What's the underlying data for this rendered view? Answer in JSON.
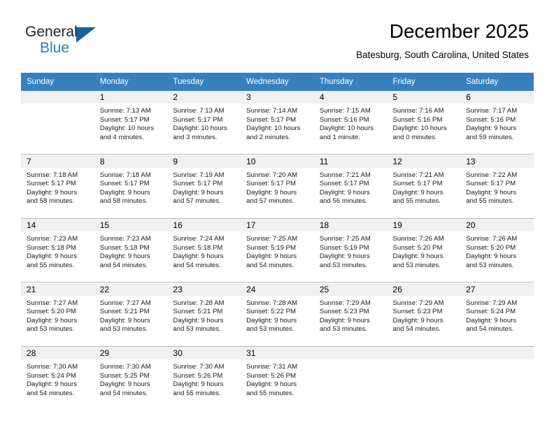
{
  "brand": {
    "name_part1": "General",
    "name_part2": "Blue"
  },
  "header": {
    "month_title": "December 2025",
    "location": "Batesburg, South Carolina, United States"
  },
  "colors": {
    "header_band": "#3680bf",
    "daynum_band": "#f0f0f0",
    "brand_blue": "#1f7fc4",
    "logo_triangle": "#1464a5"
  },
  "weekday_headers": [
    "Sunday",
    "Monday",
    "Tuesday",
    "Wednesday",
    "Thursday",
    "Friday",
    "Saturday"
  ],
  "weeks": [
    [
      {
        "day": "",
        "sunrise": "",
        "sunset": "",
        "daylight1": "",
        "daylight2": ""
      },
      {
        "day": "1",
        "sunrise": "Sunrise: 7:13 AM",
        "sunset": "Sunset: 5:17 PM",
        "daylight1": "Daylight: 10 hours",
        "daylight2": "and 4 minutes."
      },
      {
        "day": "2",
        "sunrise": "Sunrise: 7:13 AM",
        "sunset": "Sunset: 5:17 PM",
        "daylight1": "Daylight: 10 hours",
        "daylight2": "and 3 minutes."
      },
      {
        "day": "3",
        "sunrise": "Sunrise: 7:14 AM",
        "sunset": "Sunset: 5:17 PM",
        "daylight1": "Daylight: 10 hours",
        "daylight2": "and 2 minutes."
      },
      {
        "day": "4",
        "sunrise": "Sunrise: 7:15 AM",
        "sunset": "Sunset: 5:16 PM",
        "daylight1": "Daylight: 10 hours",
        "daylight2": "and 1 minute."
      },
      {
        "day": "5",
        "sunrise": "Sunrise: 7:16 AM",
        "sunset": "Sunset: 5:16 PM",
        "daylight1": "Daylight: 10 hours",
        "daylight2": "and 0 minutes."
      },
      {
        "day": "6",
        "sunrise": "Sunrise: 7:17 AM",
        "sunset": "Sunset: 5:16 PM",
        "daylight1": "Daylight: 9 hours",
        "daylight2": "and 59 minutes."
      }
    ],
    [
      {
        "day": "7",
        "sunrise": "Sunrise: 7:18 AM",
        "sunset": "Sunset: 5:17 PM",
        "daylight1": "Daylight: 9 hours",
        "daylight2": "and 58 minutes."
      },
      {
        "day": "8",
        "sunrise": "Sunrise: 7:18 AM",
        "sunset": "Sunset: 5:17 PM",
        "daylight1": "Daylight: 9 hours",
        "daylight2": "and 58 minutes."
      },
      {
        "day": "9",
        "sunrise": "Sunrise: 7:19 AM",
        "sunset": "Sunset: 5:17 PM",
        "daylight1": "Daylight: 9 hours",
        "daylight2": "and 57 minutes."
      },
      {
        "day": "10",
        "sunrise": "Sunrise: 7:20 AM",
        "sunset": "Sunset: 5:17 PM",
        "daylight1": "Daylight: 9 hours",
        "daylight2": "and 57 minutes."
      },
      {
        "day": "11",
        "sunrise": "Sunrise: 7:21 AM",
        "sunset": "Sunset: 5:17 PM",
        "daylight1": "Daylight: 9 hours",
        "daylight2": "and 56 minutes."
      },
      {
        "day": "12",
        "sunrise": "Sunrise: 7:21 AM",
        "sunset": "Sunset: 5:17 PM",
        "daylight1": "Daylight: 9 hours",
        "daylight2": "and 55 minutes."
      },
      {
        "day": "13",
        "sunrise": "Sunrise: 7:22 AM",
        "sunset": "Sunset: 5:17 PM",
        "daylight1": "Daylight: 9 hours",
        "daylight2": "and 55 minutes."
      }
    ],
    [
      {
        "day": "14",
        "sunrise": "Sunrise: 7:23 AM",
        "sunset": "Sunset: 5:18 PM",
        "daylight1": "Daylight: 9 hours",
        "daylight2": "and 55 minutes."
      },
      {
        "day": "15",
        "sunrise": "Sunrise: 7:23 AM",
        "sunset": "Sunset: 5:18 PM",
        "daylight1": "Daylight: 9 hours",
        "daylight2": "and 54 minutes."
      },
      {
        "day": "16",
        "sunrise": "Sunrise: 7:24 AM",
        "sunset": "Sunset: 5:18 PM",
        "daylight1": "Daylight: 9 hours",
        "daylight2": "and 54 minutes."
      },
      {
        "day": "17",
        "sunrise": "Sunrise: 7:25 AM",
        "sunset": "Sunset: 5:19 PM",
        "daylight1": "Daylight: 9 hours",
        "daylight2": "and 54 minutes."
      },
      {
        "day": "18",
        "sunrise": "Sunrise: 7:25 AM",
        "sunset": "Sunset: 5:19 PM",
        "daylight1": "Daylight: 9 hours",
        "daylight2": "and 53 minutes."
      },
      {
        "day": "19",
        "sunrise": "Sunrise: 7:26 AM",
        "sunset": "Sunset: 5:20 PM",
        "daylight1": "Daylight: 9 hours",
        "daylight2": "and 53 minutes."
      },
      {
        "day": "20",
        "sunrise": "Sunrise: 7:26 AM",
        "sunset": "Sunset: 5:20 PM",
        "daylight1": "Daylight: 9 hours",
        "daylight2": "and 53 minutes."
      }
    ],
    [
      {
        "day": "21",
        "sunrise": "Sunrise: 7:27 AM",
        "sunset": "Sunset: 5:20 PM",
        "daylight1": "Daylight: 9 hours",
        "daylight2": "and 53 minutes."
      },
      {
        "day": "22",
        "sunrise": "Sunrise: 7:27 AM",
        "sunset": "Sunset: 5:21 PM",
        "daylight1": "Daylight: 9 hours",
        "daylight2": "and 53 minutes."
      },
      {
        "day": "23",
        "sunrise": "Sunrise: 7:28 AM",
        "sunset": "Sunset: 5:21 PM",
        "daylight1": "Daylight: 9 hours",
        "daylight2": "and 53 minutes."
      },
      {
        "day": "24",
        "sunrise": "Sunrise: 7:28 AM",
        "sunset": "Sunset: 5:22 PM",
        "daylight1": "Daylight: 9 hours",
        "daylight2": "and 53 minutes."
      },
      {
        "day": "25",
        "sunrise": "Sunrise: 7:29 AM",
        "sunset": "Sunset: 5:23 PM",
        "daylight1": "Daylight: 9 hours",
        "daylight2": "and 53 minutes."
      },
      {
        "day": "26",
        "sunrise": "Sunrise: 7:29 AM",
        "sunset": "Sunset: 5:23 PM",
        "daylight1": "Daylight: 9 hours",
        "daylight2": "and 54 minutes."
      },
      {
        "day": "27",
        "sunrise": "Sunrise: 7:29 AM",
        "sunset": "Sunset: 5:24 PM",
        "daylight1": "Daylight: 9 hours",
        "daylight2": "and 54 minutes."
      }
    ],
    [
      {
        "day": "28",
        "sunrise": "Sunrise: 7:30 AM",
        "sunset": "Sunset: 5:24 PM",
        "daylight1": "Daylight: 9 hours",
        "daylight2": "and 54 minutes."
      },
      {
        "day": "29",
        "sunrise": "Sunrise: 7:30 AM",
        "sunset": "Sunset: 5:25 PM",
        "daylight1": "Daylight: 9 hours",
        "daylight2": "and 54 minutes."
      },
      {
        "day": "30",
        "sunrise": "Sunrise: 7:30 AM",
        "sunset": "Sunset: 5:26 PM",
        "daylight1": "Daylight: 9 hours",
        "daylight2": "and 55 minutes."
      },
      {
        "day": "31",
        "sunrise": "Sunrise: 7:31 AM",
        "sunset": "Sunset: 5:26 PM",
        "daylight1": "Daylight: 9 hours",
        "daylight2": "and 55 minutes."
      },
      {
        "day": "",
        "sunrise": "",
        "sunset": "",
        "daylight1": "",
        "daylight2": ""
      },
      {
        "day": "",
        "sunrise": "",
        "sunset": "",
        "daylight1": "",
        "daylight2": ""
      },
      {
        "day": "",
        "sunrise": "",
        "sunset": "",
        "daylight1": "",
        "daylight2": ""
      }
    ]
  ]
}
